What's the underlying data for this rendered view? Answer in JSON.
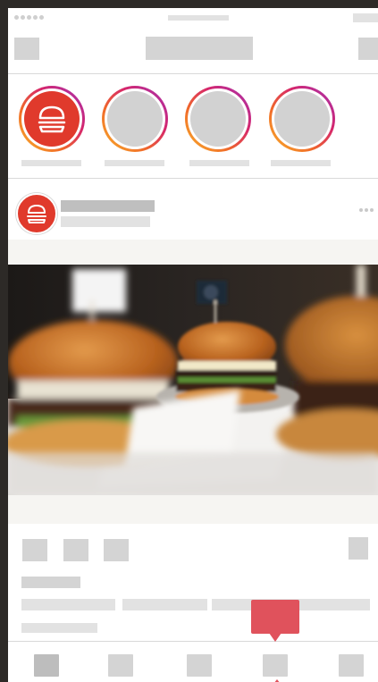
{
  "app": {
    "accent_color": "#e0525c",
    "brand_color": "#e03a2c",
    "placeholder_color": "#d4d4d4"
  },
  "status_bar": {
    "signal_icon": "signal-dots-icon"
  },
  "header": {
    "left_icon": "camera-icon",
    "right_icon": "direct-message-icon"
  },
  "stories": [
    {
      "avatar": "burger-logo-icon",
      "has_logo": true
    },
    {
      "avatar": "avatar-placeholder",
      "has_logo": false
    },
    {
      "avatar": "avatar-placeholder",
      "has_logo": false
    },
    {
      "avatar": "avatar-placeholder",
      "has_logo": false
    }
  ],
  "post": {
    "avatar_icon": "burger-logo-icon",
    "more_icon": "more-dots-icon",
    "image": "burger-photo",
    "actions": [
      "like-icon",
      "comment-icon",
      "share-icon"
    ],
    "save_icon": "bookmark-icon"
  },
  "tabbar": {
    "items": [
      "home-icon",
      "search-icon",
      "add-icon",
      "activity-icon",
      "profile-icon"
    ],
    "active_index": 0,
    "notification_index": 3
  }
}
